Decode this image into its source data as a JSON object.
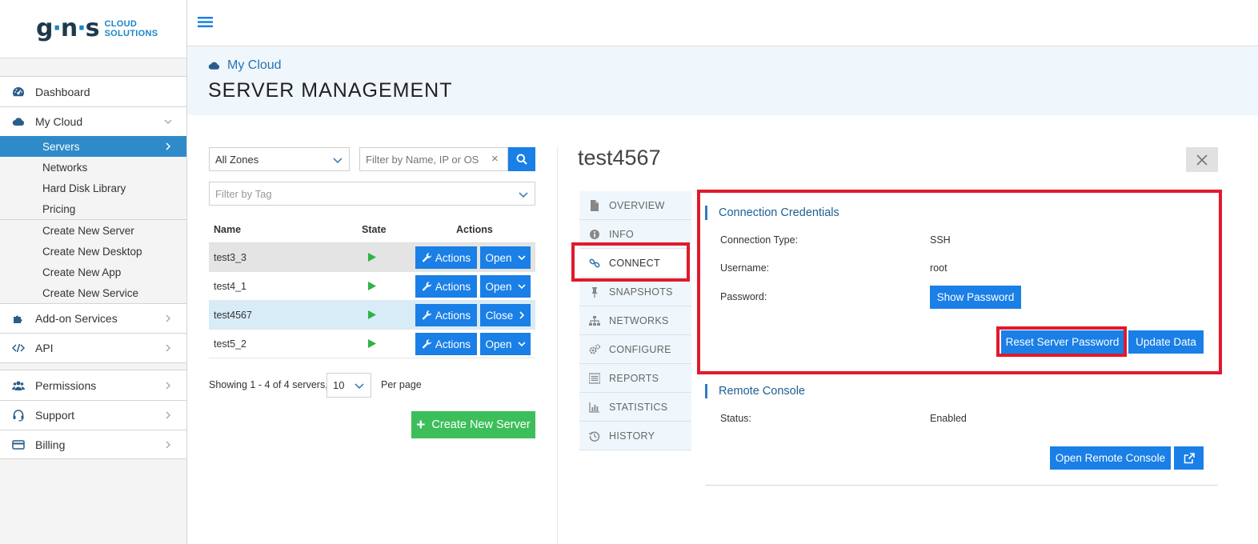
{
  "brand": {
    "logo_text_left": "g",
    "logo_dot1": "·",
    "logo_text_mid": "n",
    "logo_dot2": "·",
    "logo_text_right": "s",
    "logo_sub_1": "CLOUD",
    "logo_sub_2": "SOLUTIONS"
  },
  "sidebar": {
    "dashboard": "Dashboard",
    "my_cloud": "My Cloud",
    "sub_items": [
      "Servers",
      "Networks",
      "Hard Disk Library",
      "Pricing"
    ],
    "create_items": [
      "Create New Server",
      "Create New Desktop",
      "Create New App",
      "Create New Service"
    ],
    "addon": "Add-on Services",
    "api": "API",
    "permissions": "Permissions",
    "support": "Support",
    "billing": "Billing"
  },
  "header": {
    "breadcrumb": "My Cloud",
    "title": "SERVER MANAGEMENT"
  },
  "filters": {
    "zone": "All Zones",
    "search_placeholder": "Filter by Name, IP or OS",
    "clear": "×",
    "tag": "Filter by Tag"
  },
  "table": {
    "headers": {
      "name": "Name",
      "state": "State",
      "actions": "Actions"
    },
    "rows": [
      {
        "name": "test3_3",
        "actions": "Actions",
        "open": "Open"
      },
      {
        "name": "test4_1",
        "actions": "Actions",
        "open": "Open"
      },
      {
        "name": "test4567",
        "actions": "Actions",
        "open": "Close"
      },
      {
        "name": "test5_2",
        "actions": "Actions",
        "open": "Open"
      }
    ]
  },
  "paging": {
    "showing": "Showing 1 - 4 of 4 servers,",
    "per_page_value": "10",
    "per_page_label": "Per page"
  },
  "create_button": "Create New Server",
  "detail": {
    "server_name": "test4567",
    "tabs": [
      "OVERVIEW",
      "INFO",
      "CONNECT",
      "SNAPSHOTS",
      "NETWORKS",
      "CONFIGURE",
      "REPORTS",
      "STATISTICS",
      "HISTORY"
    ],
    "credentials": {
      "title": "Connection Credentials",
      "type_label": "Connection Type:",
      "type_value": "SSH",
      "user_label": "Username:",
      "user_value": "root",
      "pass_label": "Password:",
      "show_password": "Show Password",
      "reset_password": "Reset Server Password",
      "update_data": "Update Data"
    },
    "console": {
      "title": "Remote Console",
      "status_label": "Status:",
      "status_value": "Enabled",
      "open_console": "Open Remote Console"
    }
  },
  "colors": {
    "primary": "#1a7fe6",
    "active_nav": "#2f8ac9",
    "success": "#3cbf5a",
    "highlight": "#e01a2c",
    "state_running": "#2fb344"
  }
}
